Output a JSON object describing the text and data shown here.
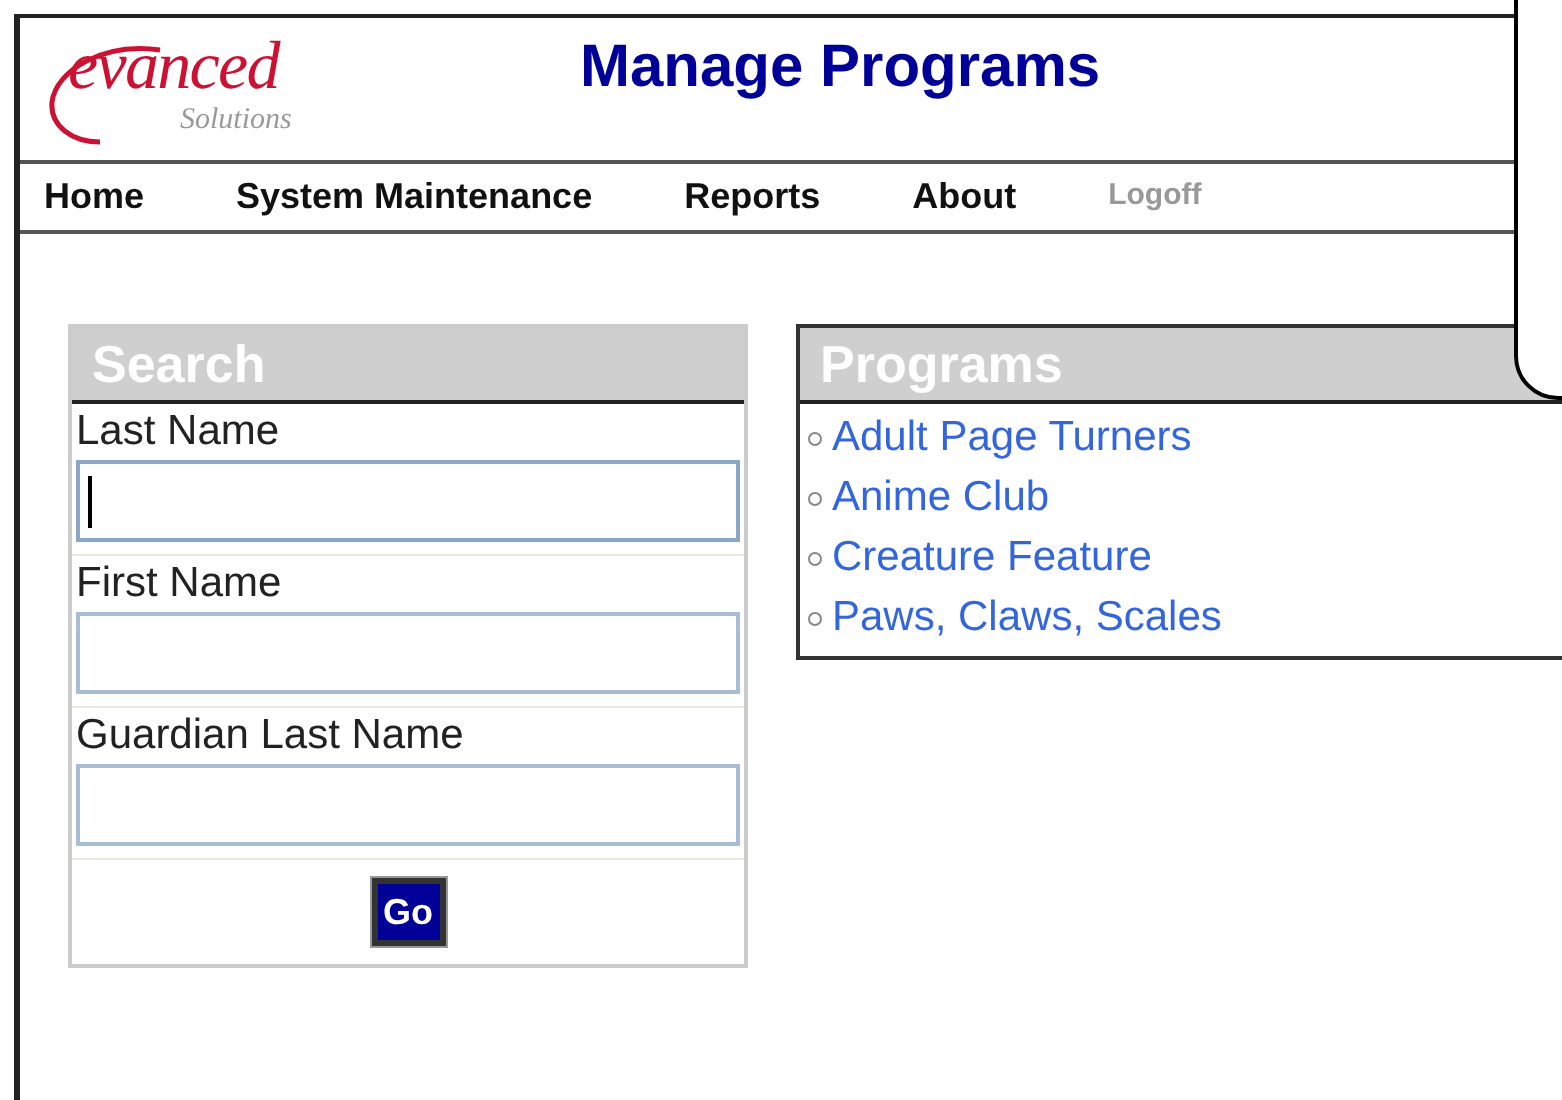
{
  "logo": {
    "name": "evanced",
    "tagline": "Solutions"
  },
  "title": "Manage Programs",
  "nav": [
    {
      "label": "Home",
      "kind": "main"
    },
    {
      "label": "System Maintenance",
      "kind": "main"
    },
    {
      "label": "Reports",
      "kind": "main"
    },
    {
      "label": "About",
      "kind": "main"
    },
    {
      "label": "Logoff",
      "kind": "minor"
    }
  ],
  "search": {
    "title": "Search",
    "fields": [
      {
        "label": "Last Name",
        "focused": true
      },
      {
        "label": "First Name",
        "focused": false
      },
      {
        "label": "Guardian Last Name",
        "focused": false
      }
    ],
    "button": "Go"
  },
  "programs": {
    "title": "Programs",
    "items": [
      "Adult Page Turners",
      "Anime Club",
      "Creature Feature",
      "Paws, Claws, Scales"
    ]
  }
}
